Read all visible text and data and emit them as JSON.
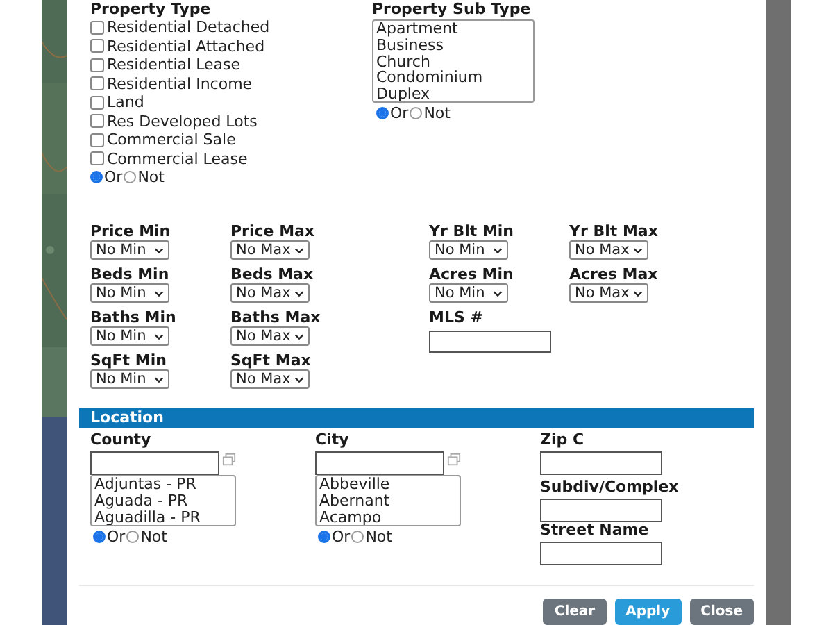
{
  "property_type": {
    "label": "Property Type",
    "options": [
      {
        "label": "Residential Detached",
        "checked": false
      },
      {
        "label": "Residential Attached",
        "checked": false
      },
      {
        "label": "Residential Lease",
        "checked": false
      },
      {
        "label": "Residential Income",
        "checked": false
      },
      {
        "label": "Land",
        "checked": false
      },
      {
        "label": "Res Developed Lots",
        "checked": false
      },
      {
        "label": "Commercial Sale",
        "checked": false
      },
      {
        "label": "Commercial Lease",
        "checked": false
      }
    ],
    "mode": [
      {
        "label": "Or",
        "selected": true
      },
      {
        "label": "Not",
        "selected": false
      }
    ]
  },
  "property_sub_type": {
    "label": "Property Sub Type",
    "items": [
      "Apartment",
      "Business",
      "Church",
      "Condominium",
      "Duplex"
    ],
    "mode": [
      {
        "label": "Or",
        "selected": true
      },
      {
        "label": "Not",
        "selected": false
      }
    ]
  },
  "range_columns": [
    [
      {
        "kind": "select",
        "label": "Price Min",
        "value": "No Min"
      },
      {
        "kind": "select",
        "label": "Beds Min",
        "value": "No Min"
      },
      {
        "kind": "select",
        "label": "Baths Min",
        "value": "No Min"
      },
      {
        "kind": "select",
        "label": "SqFt Min",
        "value": "No Min"
      }
    ],
    [
      {
        "kind": "select",
        "label": "Price Max",
        "value": "No Max"
      },
      {
        "kind": "select",
        "label": "Beds Max",
        "value": "No Max"
      },
      {
        "kind": "select",
        "label": "Baths Max",
        "value": "No Max"
      },
      {
        "kind": "select",
        "label": "SqFt Max",
        "value": "No Max"
      }
    ],
    [
      {
        "kind": "select",
        "label": "Yr Blt Min",
        "value": "No Min"
      },
      {
        "kind": "select",
        "label": "Acres Min",
        "value": "No Min"
      },
      {
        "kind": "input",
        "label": "MLS #"
      }
    ],
    [
      {
        "kind": "select",
        "label": "Yr Blt Max",
        "value": "No Max"
      },
      {
        "kind": "select",
        "label": "Acres Max",
        "value": "No Max"
      }
    ]
  ],
  "location": {
    "title": "Location",
    "lists": [
      {
        "label": "County",
        "items": [
          "Adjuntas - PR",
          "Aguada - PR",
          "Aguadilla - PR"
        ],
        "mode": [
          {
            "label": "Or",
            "selected": true
          },
          {
            "label": "Not",
            "selected": false
          }
        ]
      },
      {
        "label": "City",
        "items": [
          "Abbeville",
          "Abernant",
          "Acampo"
        ],
        "mode": [
          {
            "label": "Or",
            "selected": true
          },
          {
            "label": "Not",
            "selected": false
          }
        ]
      }
    ],
    "fields": [
      "Zip C",
      "Subdiv/Complex",
      "Street Name"
    ]
  },
  "buttons": [
    {
      "kind": "secondary",
      "label": "Clear"
    },
    {
      "kind": "primary",
      "label": "Apply"
    },
    {
      "kind": "secondary",
      "label": "Close"
    }
  ]
}
